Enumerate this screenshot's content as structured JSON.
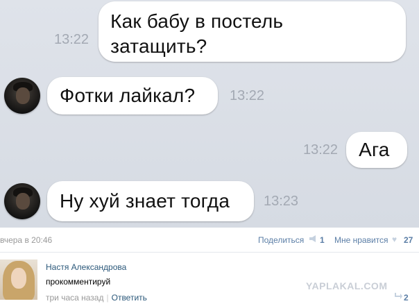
{
  "chat": {
    "messages": [
      {
        "direction": "out",
        "line1": "Как бабу в постель",
        "line2": "затащить?",
        "time": "13:22"
      },
      {
        "direction": "in",
        "text": "Фотки лайкал?",
        "time": "13:22"
      },
      {
        "direction": "out",
        "text": "Ага",
        "time": "13:22"
      },
      {
        "direction": "in",
        "text": "Ну хуй знает тогда",
        "time": "13:23"
      }
    ]
  },
  "post": {
    "date": "вчера в 20:46",
    "share_label": "Поделиться",
    "share_count": "1",
    "like_label": "Мне нравится",
    "like_count": "27"
  },
  "comment": {
    "author": "Настя Александрова",
    "text": "прокомментируй",
    "time": "три часа назад",
    "reply_label": "Ответить",
    "reply_count": "2"
  },
  "watermark": "YAPLAKAL.COM",
  "colors": {
    "chat_background": "#dadfe7",
    "bubble": "#ffffff",
    "link": "#2b587a",
    "meta": "#999999"
  }
}
